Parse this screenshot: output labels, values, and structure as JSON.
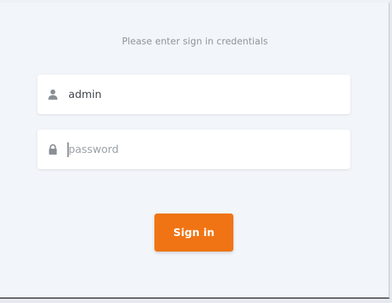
{
  "login": {
    "prompt": "Please enter sign in credentials",
    "username": {
      "value": "admin",
      "icon": "user-icon"
    },
    "password": {
      "value": "",
      "placeholder": "password",
      "icon": "lock-icon"
    },
    "signin_label": "Sign in"
  },
  "colors": {
    "background": "#f2f5f9",
    "accent": "#f07414",
    "icon": "#8a8f96"
  }
}
